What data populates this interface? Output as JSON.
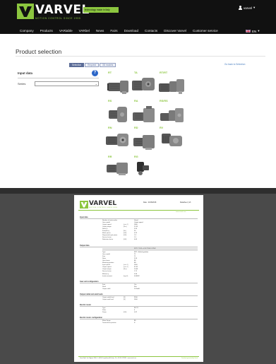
{
  "header": {
    "brand": "VARVEL",
    "brand_subline": "MOTION CONTROL SINCE 1955",
    "tagline": "technology made in Italy",
    "user": "varvel",
    "language": "EN",
    "nav": [
      "Company",
      "Products",
      "VARiable",
      "VARbel",
      "News",
      "Fairs",
      "Download",
      "Contacts",
      "Discover Varvel",
      "Customer service"
    ]
  },
  "page": {
    "title": "Product selection"
  },
  "selector": {
    "tabs": [
      "Selection",
      "Request",
      "3D models"
    ],
    "catalog_link": "Go back to Selection"
  },
  "input": {
    "title": "Input data",
    "help": "?",
    "series_label": "Series",
    "series_value": ""
  },
  "products": [
    {
      "label": "RT"
    },
    {
      "label": "TA"
    },
    {
      "label": "RT/RT"
    },
    {
      "label": "RS"
    },
    {
      "label": "RA"
    },
    {
      "label": "RS/RS"
    },
    {
      "label": "RN"
    },
    {
      "label": "RD"
    },
    {
      "label": "RV"
    },
    {
      "label": "RR"
    },
    {
      "label": "RG"
    }
  ],
  "colors": {
    "brand_green": "#8cc63f",
    "header_black": "#111111",
    "tab_active": "#5b6c97",
    "help_blue": "#2b66c8",
    "viewer_gray": "#4a4a4a"
  },
  "document": {
    "brand": "VARVEL",
    "brand_subline": "MOTION CONTROL SINCE 1955",
    "date": "Date : 21/06/2018",
    "page": "Datasheet | 1/1",
    "link": "www.varvel.com",
    "sections": [
      {
        "title": "Input data",
        "rows": [
          {
            "k": "Number of motor poles",
            "u": "",
            "v": "Varvel"
          },
          {
            "k": "Gear model",
            "u": "",
            "v": "Output speed"
          },
          {
            "k": "Output speed",
            "u": "[min-1]",
            "v": "1800"
          },
          {
            "k": "Output torque",
            "u": "[Nm]",
            "v": "12.95"
          },
          {
            "k": "Ratio (i)",
            "u": "",
            "v": "13.8"
          },
          {
            "k": "Frequency",
            "u": "[Hz]",
            "v": "50"
          },
          {
            "k": "Motor power",
            "u": "[kW]",
            "v": "0.25"
          },
          {
            "k": "Requested input power",
            "u": "[kW]",
            "v": "1.3"
          },
          {
            "k": "Service factor",
            "u": "",
            "v": "1.5"
          },
          {
            "k": "Reduction factor",
            "u": "[kW]",
            "v": "0.09"
          }
        ]
      },
      {
        "title": "Output data",
        "rows": [
          {
            "k": "Type",
            "u": "",
            "v": "FRT - Helical gearbox"
          },
          {
            "k": "Gear model",
            "u": "",
            "v": "71"
          },
          {
            "k": "Size",
            "u": "",
            "v": "71"
          },
          {
            "k": "Ratio",
            "u": "",
            "v": "13.8"
          },
          {
            "k": "Gear frame",
            "u": "",
            "v": "B5"
          },
          {
            "k": "Mounting position",
            "u": "",
            "v": "B3"
          },
          {
            "k": "Input speed",
            "u": "[min-1]",
            "v": "1400"
          },
          {
            "k": "Output speed",
            "u": "[min-1]",
            "v": "91.62"
          },
          {
            "k": "Output torque",
            "u": "[Nm]",
            "v": "10.06"
          },
          {
            "k": "Service factor",
            "u": "",
            "v": "1.71"
          },
          {
            "k": "Efficiency",
            "u": "",
            "v": "0.96"
          },
          {
            "k": "Inertia moment",
            "u": "[kgm2]",
            "v": "0.00032"
          }
        ]
      },
      {
        "title": "Gear unit configuration",
        "rows": [
          {
            "k": "Foot",
            "u": "",
            "v": "Yes"
          },
          {
            "k": "Shaft",
            "u": "",
            "v": "Flat"
          },
          {
            "k": "Output shaft",
            "u": "",
            "v": "D.20x40"
          }
        ]
      },
      {
        "title": "Output radial and axial loads",
        "rows": [
          {
            "k": "Output radial load",
            "u": "[N]",
            "v": "3500"
          },
          {
            "k": "Output axial load",
            "u": "[N]",
            "v": "1400"
          }
        ]
      },
      {
        "title": "Electric motor",
        "rows": [
          {
            "k": "Type",
            "u": "",
            "v": "IEC71"
          },
          {
            "k": "Poles",
            "u": "",
            "v": "4"
          },
          {
            "k": "Power",
            "u": "[kW]",
            "v": "0.37"
          }
        ]
      },
      {
        "title": "Electric motor configuration",
        "rows": [
          {
            "k": "Motor flange",
            "u": "",
            "v": "B5"
          },
          {
            "k": "Terminal box position",
            "u": "",
            "v": "0°"
          }
        ]
      }
    ],
    "output_bar": "FRT1 71 B5 i=13.8 71B4 0.37kW",
    "footer": "Varvel SpA - Via 2 Agosto 1980, 9 - 40056 Crespellano (BO) Italy - Tel. +39 051 6721811 - www.varvel.com",
    "footer_right": "Datasheet generated by Varvel"
  }
}
